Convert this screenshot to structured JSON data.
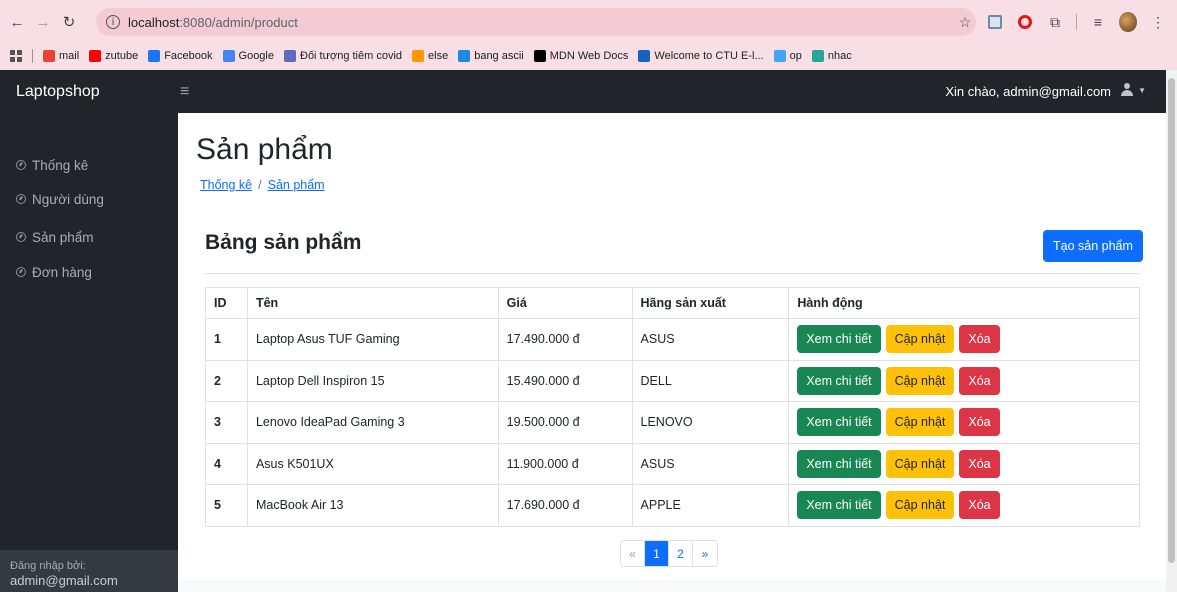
{
  "browser": {
    "url_host": "localhost",
    "url_path": ":8080/admin/product",
    "bookmarks": [
      {
        "label": "mail",
        "color": "#ea4335"
      },
      {
        "label": "zutube",
        "color": "#ff0000"
      },
      {
        "label": "Facebook",
        "color": "#1877f2"
      },
      {
        "label": "Google",
        "color": "#4285f4"
      },
      {
        "label": "Đối tượng tiêm covid",
        "color": "#5c6bc0"
      },
      {
        "label": "else",
        "color": "#ff9800"
      },
      {
        "label": "bang ascii",
        "color": "#1e88e5"
      },
      {
        "label": "MDN Web Docs",
        "color": "#000000"
      },
      {
        "label": "Welcome to CTU E-l...",
        "color": "#1565c0"
      },
      {
        "label": "op",
        "color": "#42a5f5"
      },
      {
        "label": "nhac",
        "color": "#26a69a"
      }
    ]
  },
  "navbar": {
    "brand": "Laptopshop",
    "greeting": "Xin chào, admin@gmail.com"
  },
  "sidebar": {
    "items": [
      {
        "label": "Thống kê"
      },
      {
        "label": "Người dùng"
      },
      {
        "label": "Sản phẩm"
      },
      {
        "label": "Đơn hàng"
      }
    ],
    "footer_label": "Đăng nhập bởi:",
    "footer_value": "admin@gmail.com"
  },
  "main": {
    "title": "Sản phẩm",
    "breadcrumb": [
      "Thống kê",
      "Sản phẩm"
    ],
    "breadcrumb_sep": "/",
    "section_title": "Bảng sản phẩm",
    "create_button": "Tạo sản phẩm",
    "table": {
      "headers": [
        "ID",
        "Tên",
        "Giá",
        "Hãng sản xuất",
        "Hành động"
      ],
      "rows": [
        {
          "id": "1",
          "name": "Laptop Asus TUF Gaming",
          "price": "17.490.000 đ",
          "brand": "ASUS"
        },
        {
          "id": "2",
          "name": "Laptop Dell Inspiron 15",
          "price": "15.490.000 đ",
          "brand": "DELL"
        },
        {
          "id": "3",
          "name": "Lenovo IdeaPad Gaming 3",
          "price": "19.500.000 đ",
          "brand": "LENOVO"
        },
        {
          "id": "4",
          "name": "Asus K501UX",
          "price": "11.900.000 đ",
          "brand": "ASUS"
        },
        {
          "id": "5",
          "name": "MacBook Air 13",
          "price": "17.690.000 đ",
          "brand": "APPLE"
        }
      ],
      "actions": {
        "view": "Xem chi tiết",
        "edit": "Cập nhật",
        "delete": "Xóa"
      }
    },
    "pagination": {
      "prev": "«",
      "pages": [
        "1",
        "2"
      ],
      "active_page": "1",
      "next": "»"
    }
  }
}
